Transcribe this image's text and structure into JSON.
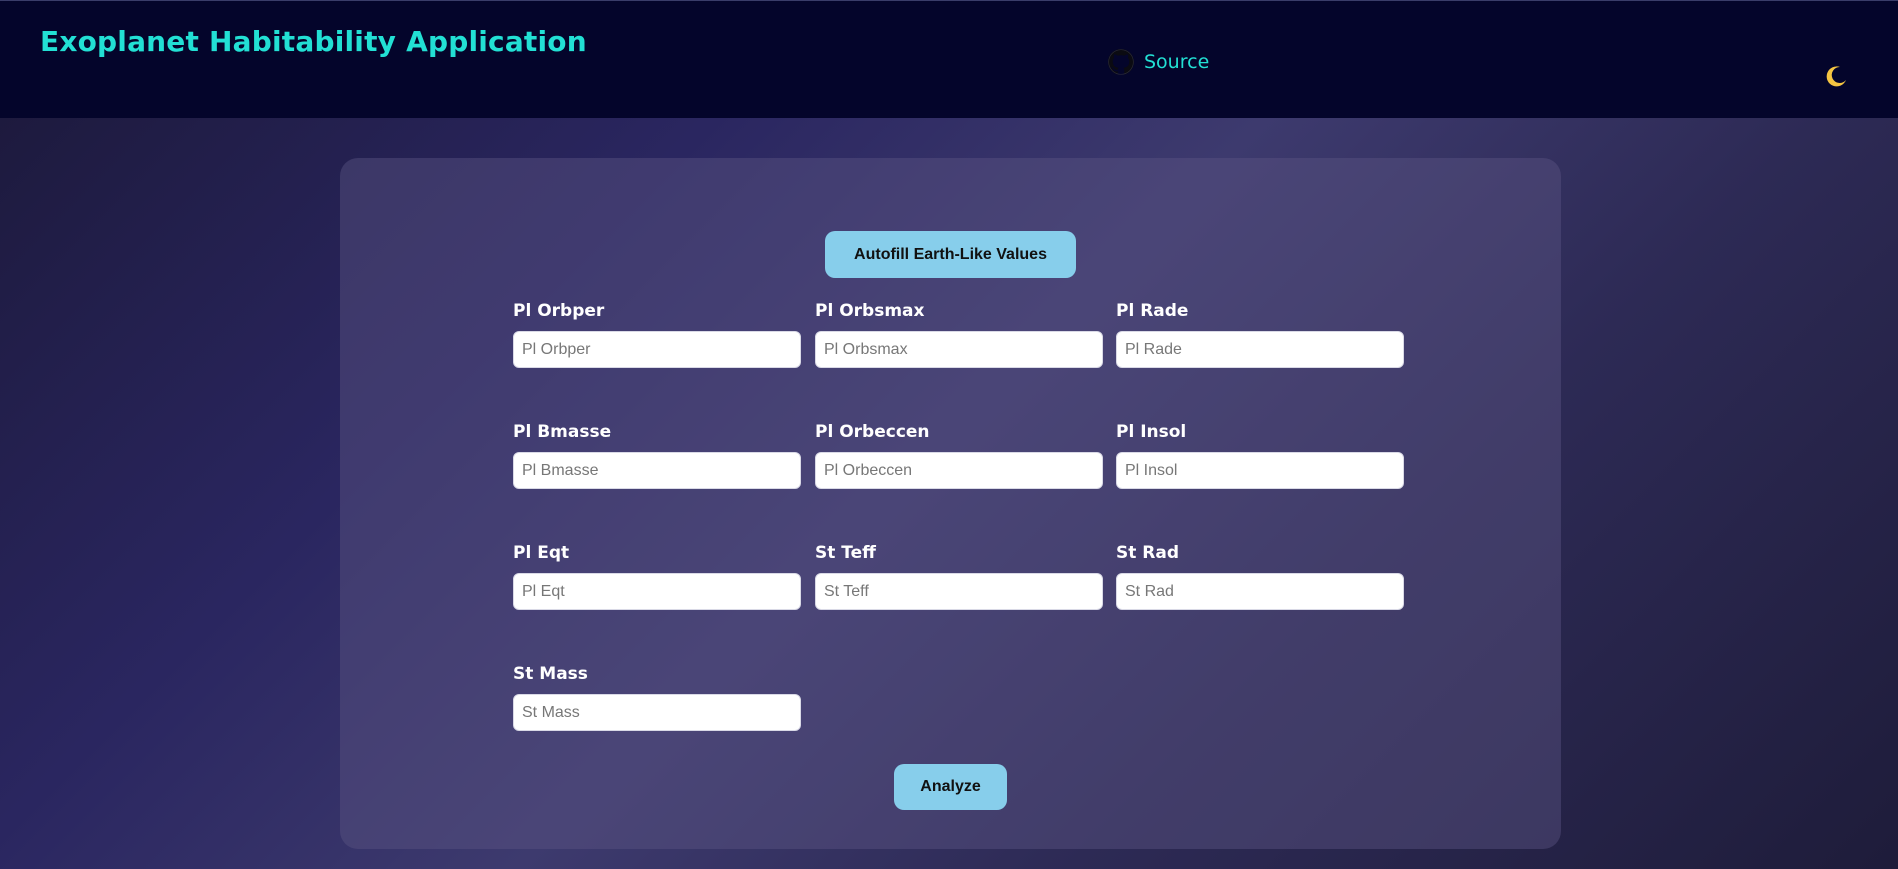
{
  "header": {
    "title": "Exoplanet Habitability Application",
    "source_label": "Source",
    "source_icon": "github-icon",
    "theme_icon": "moon-icon"
  },
  "form": {
    "autofill_label": "Autofill Earth-Like Values",
    "fields": [
      {
        "label": "Pl Orbper",
        "placeholder": "Pl Orbper",
        "value": ""
      },
      {
        "label": "Pl Orbsmax",
        "placeholder": "Pl Orbsmax",
        "value": ""
      },
      {
        "label": "Pl Rade",
        "placeholder": "Pl Rade",
        "value": ""
      },
      {
        "label": "Pl Bmasse",
        "placeholder": "Pl Bmasse",
        "value": ""
      },
      {
        "label": "Pl Orbeccen",
        "placeholder": "Pl Orbeccen",
        "value": ""
      },
      {
        "label": "Pl Insol",
        "placeholder": "Pl Insol",
        "value": ""
      },
      {
        "label": "Pl Eqt",
        "placeholder": "Pl Eqt",
        "value": ""
      },
      {
        "label": "St Teff",
        "placeholder": "St Teff",
        "value": ""
      },
      {
        "label": "St Rad",
        "placeholder": "St Rad",
        "value": ""
      },
      {
        "label": "St Mass",
        "placeholder": "St Mass",
        "value": ""
      }
    ],
    "analyze_label": "Analyze"
  },
  "colors": {
    "accent": "#22e0d4",
    "header_bg": "#04052b",
    "button_bg": "#87ceeb",
    "moon": "#f5c542"
  }
}
